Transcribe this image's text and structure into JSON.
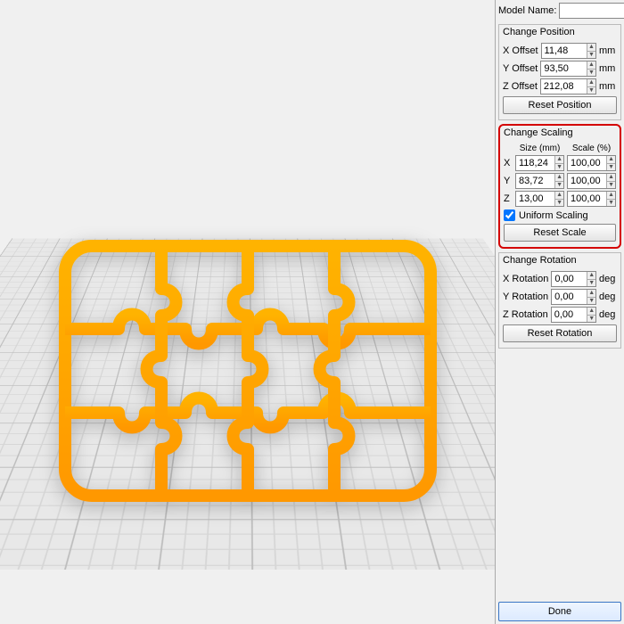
{
  "modelName": {
    "label": "Model Name:",
    "value": ""
  },
  "position": {
    "title": "Change Position",
    "x": {
      "label": "X Offset",
      "value": "11,48",
      "unit": "mm"
    },
    "y": {
      "label": "Y Offset",
      "value": "93,50",
      "unit": "mm"
    },
    "z": {
      "label": "Z Offset",
      "value": "212,08",
      "unit": "mm"
    },
    "reset": "Reset Position"
  },
  "scaling": {
    "title": "Change Scaling",
    "sizeHeader": "Size (mm)",
    "scaleHeader": "Scale (%)",
    "x": {
      "label": "X",
      "size": "118,24",
      "scale": "100,00"
    },
    "y": {
      "label": "Y",
      "size": "83,72",
      "scale": "100,00"
    },
    "z": {
      "label": "Z",
      "size": "13,00",
      "scale": "100,00"
    },
    "uniform": {
      "label": "Uniform Scaling",
      "checked": true
    },
    "reset": "Reset Scale"
  },
  "rotation": {
    "title": "Change Rotation",
    "x": {
      "label": "X Rotation",
      "value": "0,00",
      "unit": "deg"
    },
    "y": {
      "label": "Y Rotation",
      "value": "0,00",
      "unit": "deg"
    },
    "z": {
      "label": "Z Rotation",
      "value": "0,00",
      "unit": "deg"
    },
    "reset": "Reset Rotation"
  },
  "done": "Done"
}
